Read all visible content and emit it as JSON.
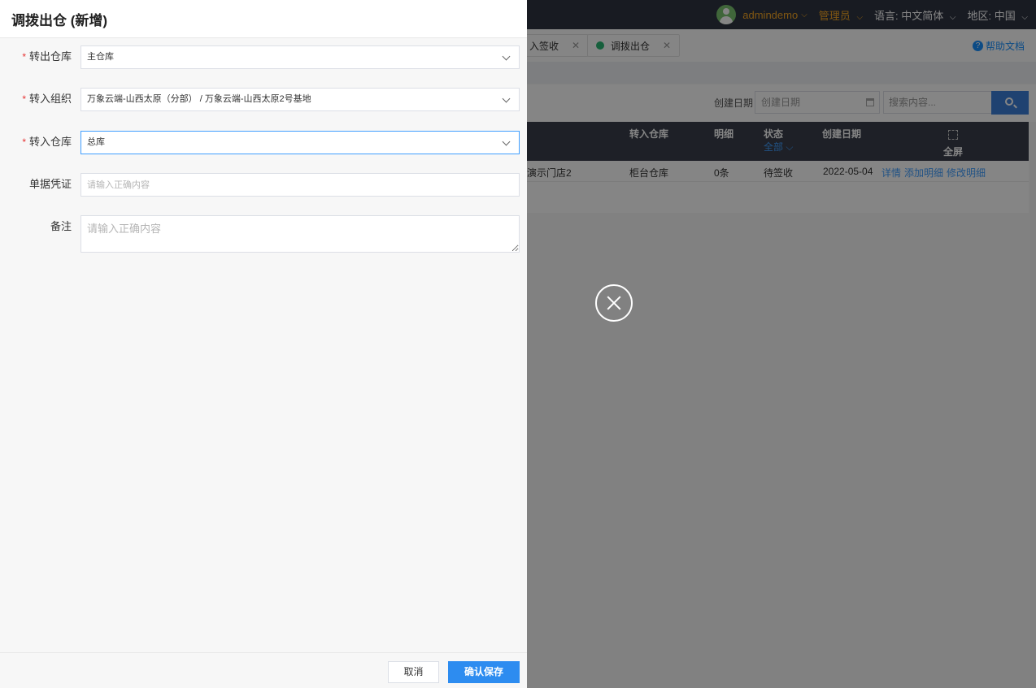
{
  "topbar": {
    "user": "admindemo",
    "role": "管理员",
    "language_label": "语言:",
    "language_value": "中文简体",
    "region_label": "地区:",
    "region_value": "中国"
  },
  "tabs": [
    {
      "label": "入签收"
    },
    {
      "label": "调拨出仓"
    }
  ],
  "help_label": "帮助文档",
  "filter": {
    "date_label": "创建日期",
    "date_placeholder": "创建日期",
    "search_placeholder": "搜索内容..."
  },
  "table": {
    "headers": {
      "to_warehouse": "转入仓库",
      "detail": "明细",
      "status": "状态",
      "status_filter": "全部",
      "created": "创建日期",
      "fullscreen": "全屏"
    },
    "rows": [
      {
        "store": "演示门店2",
        "to_warehouse": "柜台仓库",
        "detail": "0条",
        "status": "待签收",
        "created": "2022-05-04",
        "actions": [
          "详情",
          "添加明细",
          "修改明细"
        ]
      }
    ]
  },
  "drawer": {
    "title": "调拨出仓 (新增)",
    "fields": {
      "out_warehouse": {
        "label": "转出仓库",
        "value": "主仓库",
        "required": true
      },
      "in_org": {
        "label": "转入组织",
        "value": "万象云端-山西太原（分部） / 万象云端-山西太原2号基地",
        "required": true
      },
      "in_warehouse": {
        "label": "转入仓库",
        "value": "总库",
        "required": true
      },
      "voucher": {
        "label": "单据凭证",
        "placeholder": "请输入正确内容"
      },
      "remark": {
        "label": "备注",
        "placeholder": "请输入正确内容"
      }
    },
    "required_mark": "*",
    "cancel_label": "取消",
    "save_label": "确认保存"
  },
  "colors": {
    "primary": "#2d8cf0",
    "required": "#e63333",
    "topbar": "#2f3542",
    "accent_user": "#f5a623"
  }
}
